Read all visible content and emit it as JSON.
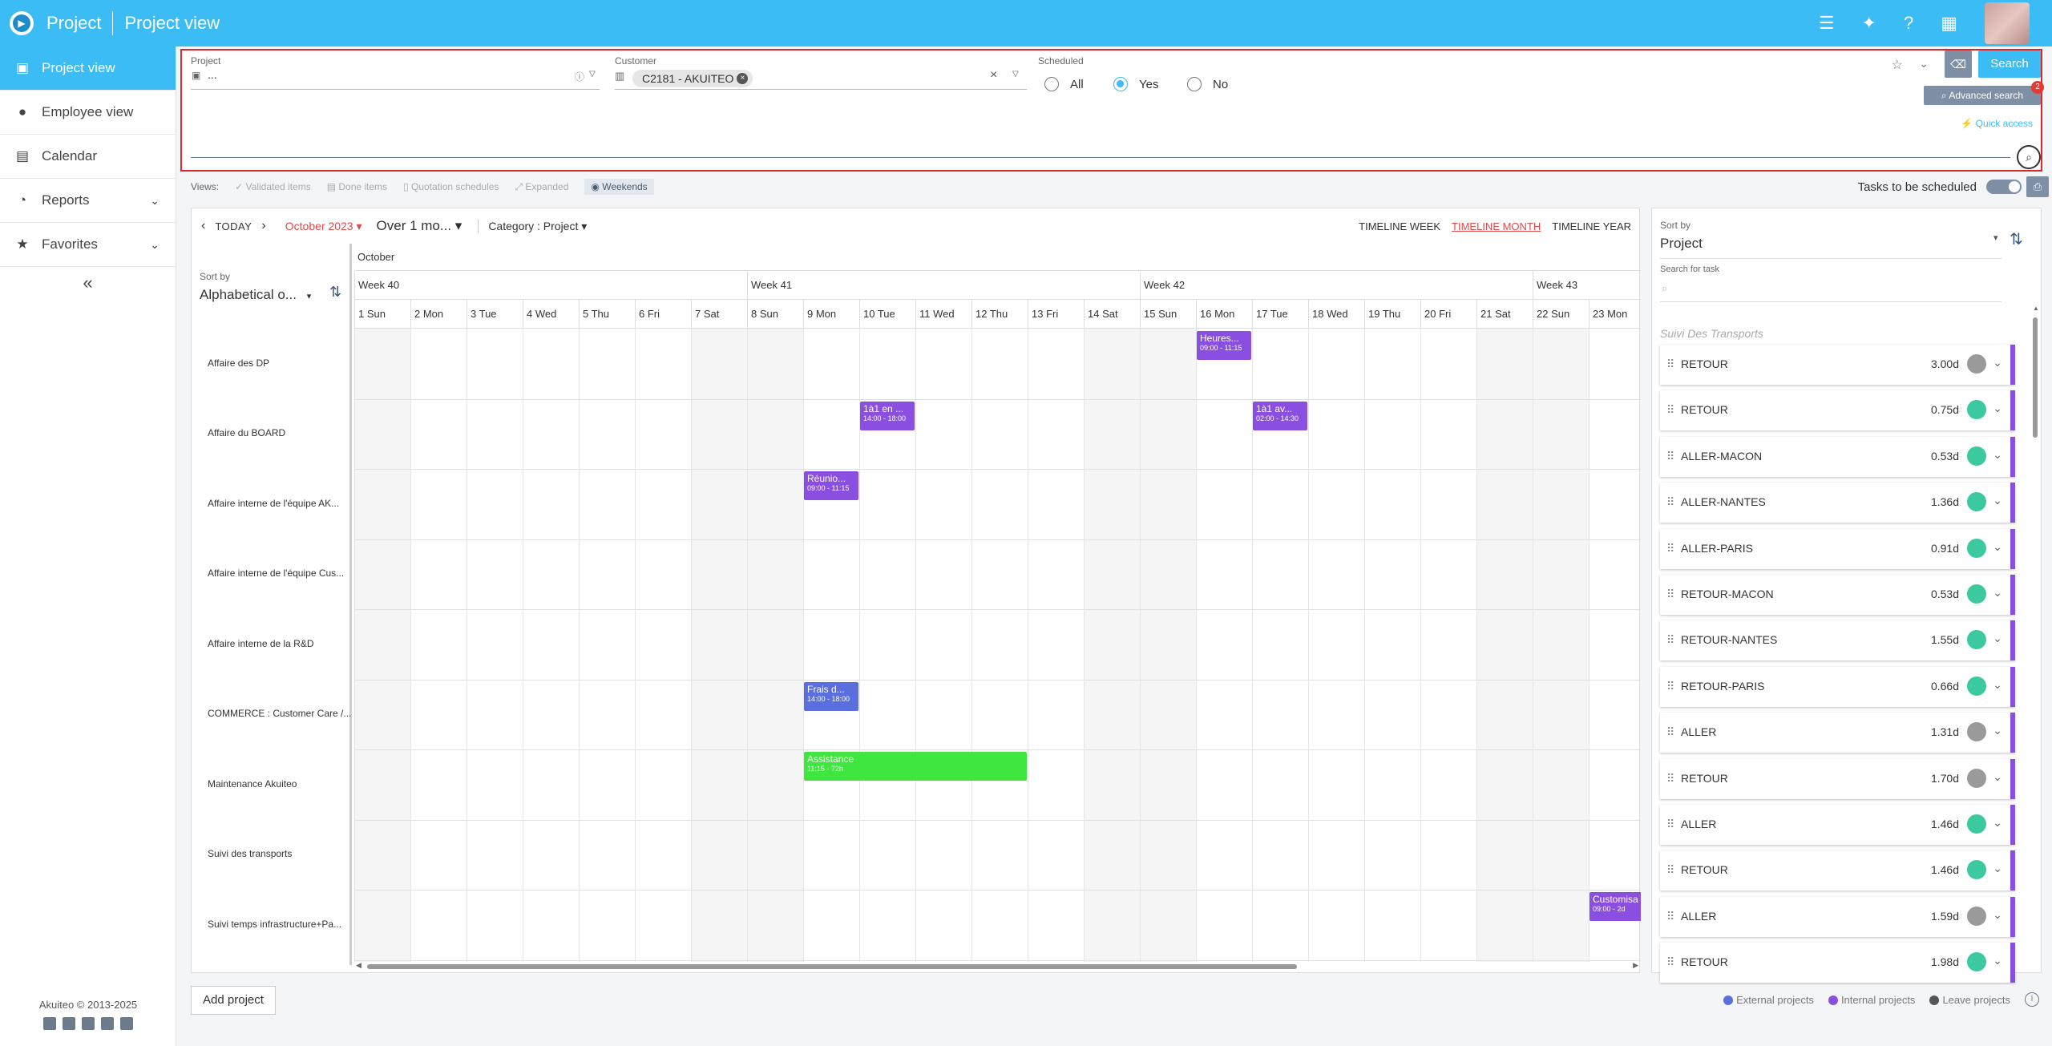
{
  "header": {
    "app_title": "Project",
    "page_title": "Project view"
  },
  "sidebar": {
    "items": [
      {
        "label": "Project view",
        "icon": "briefcase-icon"
      },
      {
        "label": "Employee view",
        "icon": "person-icon"
      },
      {
        "label": "Calendar",
        "icon": "calendar-icon"
      },
      {
        "label": "Reports",
        "icon": "chart-icon"
      },
      {
        "label": "Favorites",
        "icon": "star-icon"
      }
    ],
    "collapse": "«",
    "footer": "Akuiteo © 2013-2025"
  },
  "search": {
    "project_label": "Project",
    "project_value": "...",
    "customer_label": "Customer",
    "customer_chip": "C2181 - AKUITEO",
    "scheduled_label": "Scheduled",
    "opt_all": "All",
    "opt_yes": "Yes",
    "opt_no": "No",
    "search_button": "Search",
    "advanced_button": "Advanced search",
    "advanced_badge": "2",
    "quick_access": "Quick access"
  },
  "views": {
    "label": "Views:",
    "validated": "Validated items",
    "done": "Done items",
    "quotation": "Quotation schedules",
    "expanded": "Expanded",
    "weekends": "Weekends",
    "tasks_toggle": "Tasks to be scheduled"
  },
  "planner": {
    "today": "TODAY",
    "month": "October 2023",
    "range": "Over 1 mo...",
    "category": "Category : Project",
    "view_week": "TIMELINE WEEK",
    "view_month": "TIMELINE MONTH",
    "view_year": "TIMELINE YEAR",
    "sort_label": "Sort by",
    "sort_value": "Alphabetical o...",
    "month_header": "October",
    "weeks": [
      "Week 40",
      "Week 41",
      "Week 42",
      "Week 43"
    ],
    "days": [
      "1 Sun",
      "2 Mon",
      "3 Tue",
      "4 Wed",
      "5 Thu",
      "6 Fri",
      "7 Sat",
      "8 Sun",
      "9 Mon",
      "10 Tue",
      "11 Wed",
      "12 Thu",
      "13 Fri",
      "14 Sat",
      "15 Sun",
      "16 Mon",
      "17 Tue",
      "18 Wed",
      "19 Thu",
      "20 Fri",
      "21 Sat",
      "22 Sun",
      "23 Mon"
    ],
    "rows": [
      "Affaire des DP",
      "Affaire du BOARD",
      "Affaire interne de l'équipe AK...",
      "Affaire interne de l'équipe Cus...",
      "Affaire interne de la R&D",
      "COMMERCE : Customer Care /...",
      "Maintenance Akuiteo",
      "Suivi des transports",
      "Suivi temps infrastructure+Pa..."
    ],
    "events": [
      {
        "title": "Heures...",
        "time": "09:00 - 11:15",
        "row": 0,
        "day": 15,
        "span": 1,
        "color": "purple"
      },
      {
        "title": "1à1 en ...",
        "time": "14:00 - 18:00",
        "row": 1,
        "day": 9,
        "span": 1,
        "color": "purple"
      },
      {
        "title": "1à1 av...",
        "time": "02:00 - 14:30",
        "row": 1,
        "day": 16,
        "span": 1,
        "color": "purple"
      },
      {
        "title": "Réunio...",
        "time": "09:00 - 11:15",
        "row": 2,
        "day": 8,
        "span": 1,
        "color": "purple"
      },
      {
        "title": "Frais d...",
        "time": "14:00 - 18:00",
        "row": 5,
        "day": 8,
        "span": 1,
        "color": "blue"
      },
      {
        "title": "Assistance",
        "time": "11:15 - 72h",
        "row": 6,
        "day": 8,
        "span": 4,
        "color": "green"
      },
      {
        "title": "Customisa",
        "time": "09:00 - 2d",
        "row": 8,
        "day": 22,
        "span": 1,
        "color": "purple"
      }
    ],
    "add_project": "Add project"
  },
  "tasks": {
    "sort_label": "Sort by",
    "sort_value": "Project",
    "search_label": "Search for task",
    "section": "Suivi Des Transports",
    "items": [
      {
        "name": "RETOUR",
        "duration": "3.00d",
        "status": "grey"
      },
      {
        "name": "RETOUR",
        "duration": "0.75d",
        "status": "teal"
      },
      {
        "name": "ALLER-MACON",
        "duration": "0.53d",
        "status": "teal"
      },
      {
        "name": "ALLER-NANTES",
        "duration": "1.36d",
        "status": "teal"
      },
      {
        "name": "ALLER-PARIS",
        "duration": "0.91d",
        "status": "teal"
      },
      {
        "name": "RETOUR-MACON",
        "duration": "0.53d",
        "status": "teal"
      },
      {
        "name": "RETOUR-NANTES",
        "duration": "1.55d",
        "status": "teal"
      },
      {
        "name": "RETOUR-PARIS",
        "duration": "0.66d",
        "status": "teal"
      },
      {
        "name": "ALLER",
        "duration": "1.31d",
        "status": "grey"
      },
      {
        "name": "RETOUR",
        "duration": "1.70d",
        "status": "grey"
      },
      {
        "name": "ALLER",
        "duration": "1.46d",
        "status": "teal"
      },
      {
        "name": "RETOUR",
        "duration": "1.46d",
        "status": "teal"
      },
      {
        "name": "ALLER",
        "duration": "1.59d",
        "status": "grey"
      },
      {
        "name": "RETOUR",
        "duration": "1.98d",
        "status": "teal"
      }
    ]
  },
  "legend": {
    "external": "External projects",
    "internal": "Internal projects",
    "leave": "Leave projects"
  },
  "colors": {
    "accent": "#3bbcf5",
    "purple": "#8a4fe0",
    "blue": "#5a6ee0",
    "green": "#3fe63f",
    "teal": "#3cc9a0",
    "grey": "#9a9a9a",
    "today_red": "#e04a4a"
  }
}
